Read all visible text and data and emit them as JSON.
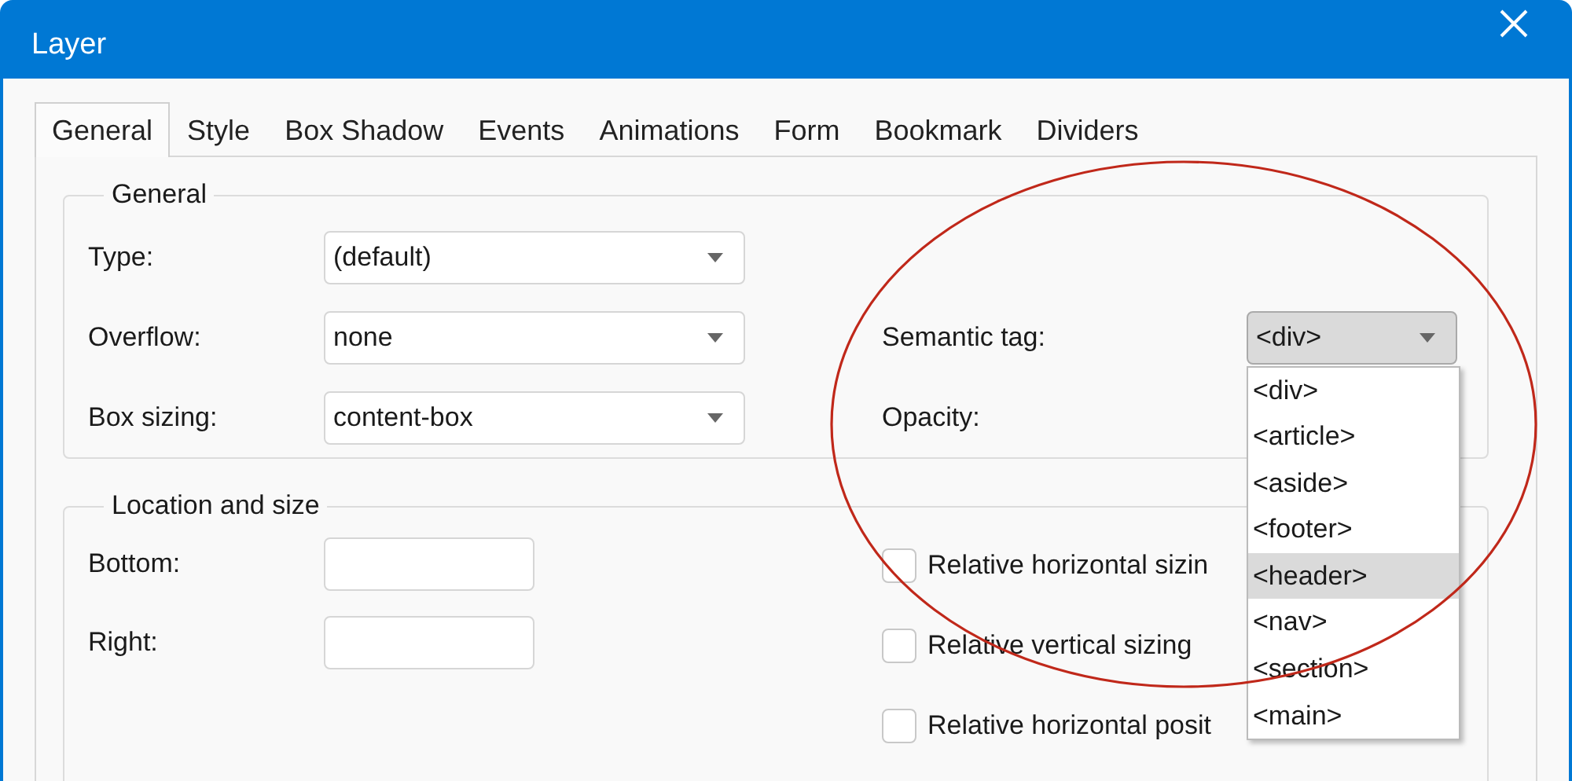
{
  "window": {
    "title": "Layer"
  },
  "tabs": [
    {
      "label": "General",
      "selected": true
    },
    {
      "label": "Style",
      "selected": false
    },
    {
      "label": "Box Shadow",
      "selected": false
    },
    {
      "label": "Events",
      "selected": false
    },
    {
      "label": "Animations",
      "selected": false
    },
    {
      "label": "Form",
      "selected": false
    },
    {
      "label": "Bookmark",
      "selected": false
    },
    {
      "label": "Dividers",
      "selected": false
    }
  ],
  "general": {
    "title": "General",
    "type": {
      "label": "Type:",
      "value": "(default)"
    },
    "overflow": {
      "label": "Overflow:",
      "value": "none"
    },
    "box_sizing": {
      "label": "Box sizing:",
      "value": "content-box"
    },
    "semantic_tag": {
      "label": "Semantic tag:",
      "value": "<div>",
      "expanded": true,
      "options": [
        {
          "label": "<div>",
          "highlighted": false
        },
        {
          "label": "<article>",
          "highlighted": false
        },
        {
          "label": "<aside>",
          "highlighted": false
        },
        {
          "label": "<footer>",
          "highlighted": false
        },
        {
          "label": "<header>",
          "highlighted": true
        },
        {
          "label": "<nav>",
          "highlighted": false
        },
        {
          "label": "<section>",
          "highlighted": false
        },
        {
          "label": "<main>",
          "highlighted": false
        }
      ]
    },
    "opacity": {
      "label": "Opacity:"
    }
  },
  "location_and_size": {
    "title": "Location and size",
    "fields": [
      {
        "label": "Bottom:"
      },
      {
        "label": "Right:"
      }
    ],
    "checkboxes": [
      {
        "label": "Relative horizontal sizin",
        "checked": false
      },
      {
        "label": "Relative vertical sizing",
        "checked": false
      },
      {
        "label": "Relative horizontal posit",
        "checked": false
      }
    ]
  }
}
